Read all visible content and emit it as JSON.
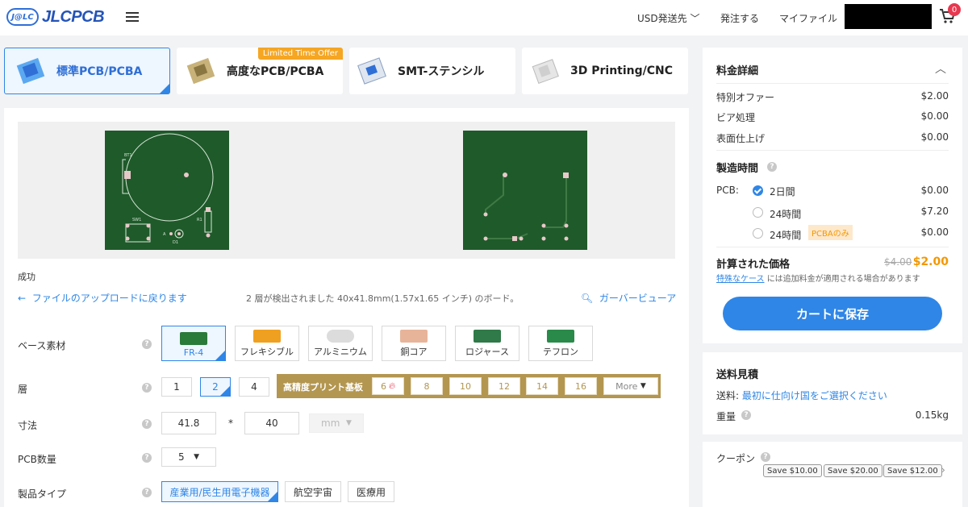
{
  "header": {
    "logo_mark": "J@LC",
    "logo_text": "JLCPCB",
    "currency": "USD発送先",
    "order": "発注する",
    "my_files": "マイファイル",
    "cart_count": "0"
  },
  "tabs": [
    {
      "label": "標準PCB/PCBA"
    },
    {
      "label": "高度なPCB/PCBA",
      "badge": "Limited Time Offer"
    },
    {
      "label": "SMT-ステンシル"
    },
    {
      "label": "3D Printing/CNC"
    }
  ],
  "upload": {
    "success": "成功",
    "back": "ファイルのアップロードに戻ります",
    "detected": "2 層が検出されました 40x41.8mm(1.57x1.65 インチ) のボード。",
    "gerber": "ガーバービューア"
  },
  "pcb_labels": {
    "bt1": "BT1",
    "sw1": "SW1",
    "r1": "R1",
    "d1": "D1",
    "a": "A"
  },
  "form": {
    "base_material": {
      "label": "ベース素材",
      "options": [
        "FR-4",
        "フレキシブル",
        "アルミニウム",
        "銅コア",
        "ロジャース",
        "テフロン"
      ]
    },
    "layers": {
      "label": "層",
      "options": [
        "1",
        "2",
        "4"
      ],
      "hd_label": "高精度プリント基板",
      "hd_options": [
        "6",
        "8",
        "10",
        "12",
        "14",
        "16"
      ],
      "more": "More"
    },
    "dimension": {
      "label": "寸法",
      "w": "41.8",
      "sep": "*",
      "h": "40",
      "unit": "mm"
    },
    "qty": {
      "label": "PCB数量",
      "value": "5"
    },
    "product_type": {
      "label": "製品タイプ",
      "options": [
        "産業用/民生用電子機器",
        "航空宇宙",
        "医療用"
      ]
    }
  },
  "charges": {
    "title": "料金詳細",
    "items": [
      {
        "label": "特別オファー",
        "value": "$2.00"
      },
      {
        "label": "ビア処理",
        "value": "$0.00"
      },
      {
        "label": "表面仕上げ",
        "value": "$0.00"
      }
    ],
    "build_time_title": "製造時間",
    "pcb_label": "PCB:",
    "build_options": [
      {
        "label": "2日間",
        "value": "$0.00"
      },
      {
        "label": "24時間",
        "value": "$7.20"
      },
      {
        "label": "24時間",
        "value": "$0.00",
        "badge": "PCBAのみ"
      }
    ],
    "calc_title": "計算された価格",
    "old_price": "$4.00",
    "price": "$2.00",
    "note_link": "特殊なケース",
    "note_rest": "には追加料金が適用される場合があります",
    "cart_button": "カートに保存"
  },
  "shipping": {
    "title": "送料見積",
    "ship_label": "送料:",
    "ship_link": "最初に仕向け国をご選択ください",
    "weight_label": "重量",
    "weight_value": "0.15kg"
  },
  "coupon": {
    "title": "クーポン",
    "tags": [
      "Save $10.00",
      "Save $20.00",
      "Save $12.00"
    ]
  },
  "colors": {
    "accent": "#2f86e6",
    "gold": "#b39650",
    "orange": "#f39800",
    "pcb_green": "#1f5a2a"
  }
}
